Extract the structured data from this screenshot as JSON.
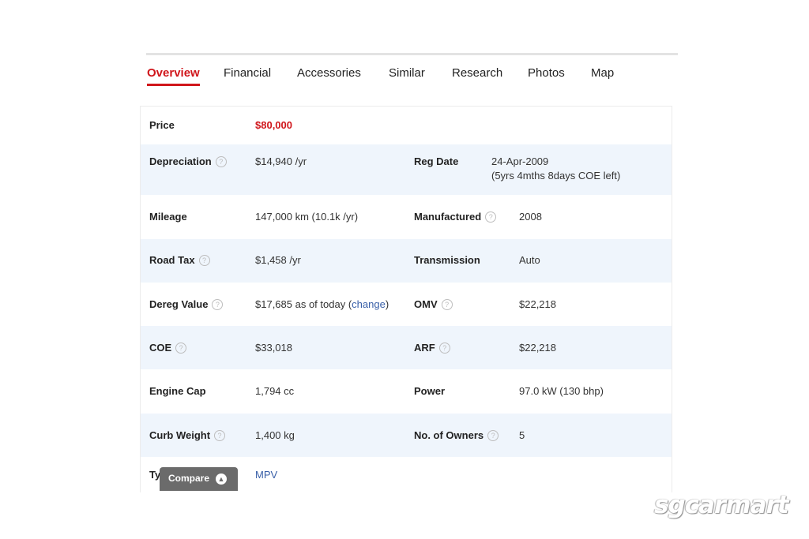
{
  "tabs": [
    {
      "label": "Overview",
      "active": true
    },
    {
      "label": "Financial"
    },
    {
      "label": "Accessories"
    },
    {
      "label": "Similar"
    },
    {
      "label": "Research"
    },
    {
      "label": "Photos"
    },
    {
      "label": "Map"
    }
  ],
  "details": {
    "price": {
      "label": "Price",
      "value": "$80,000"
    },
    "depreciation": {
      "label": "Depreciation",
      "value": "$14,940 /yr"
    },
    "reg_date": {
      "label": "Reg Date",
      "value": "24-Apr-2009",
      "sub": "(5yrs 4mths 8days COE left)"
    },
    "mileage": {
      "label": "Mileage",
      "value": "147,000 km (10.1k /yr)"
    },
    "manufactured": {
      "label": "Manufactured",
      "value": "2008"
    },
    "road_tax": {
      "label": "Road Tax",
      "value": "$1,458 /yr"
    },
    "transmission": {
      "label": "Transmission",
      "value": "Auto"
    },
    "dereg_value": {
      "label": "Dereg Value",
      "value": "$17,685 as of today (",
      "link": "change",
      "suffix": ")"
    },
    "omv": {
      "label": "OMV",
      "value": "$22,218"
    },
    "coe": {
      "label": "COE",
      "value": "$33,018"
    },
    "arf": {
      "label": "ARF",
      "value": "$22,218"
    },
    "engine_cap": {
      "label": "Engine Cap",
      "value": "1,794 cc"
    },
    "power": {
      "label": "Power",
      "value": "97.0 kW (130 bhp)"
    },
    "curb_weight": {
      "label": "Curb Weight",
      "value": "1,400 kg"
    },
    "owners": {
      "label": "No. of Owners",
      "value": "5"
    },
    "type": {
      "label": "Ty",
      "value": "MPV"
    }
  },
  "help_icon": "?",
  "compare": {
    "label": "Compare",
    "icon": "chevron-up-icon"
  },
  "watermark": "sgcarmart"
}
